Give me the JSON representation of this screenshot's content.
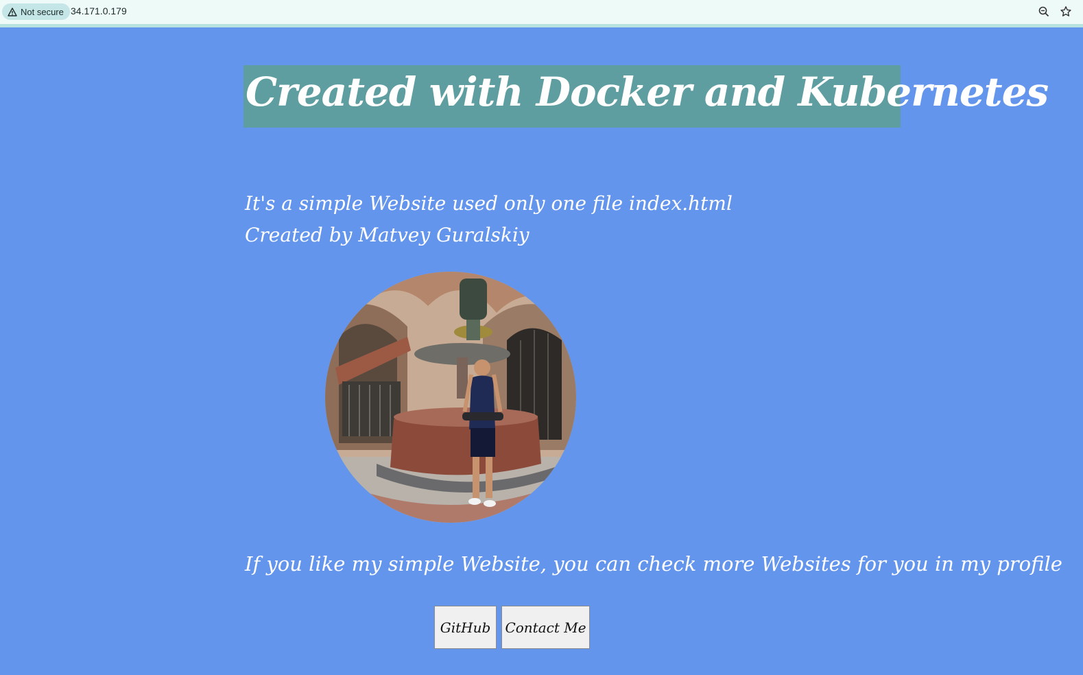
{
  "browser": {
    "security_label": "Not secure",
    "url": "34.171.0.179",
    "icons": [
      "warning-icon",
      "zoom-icon",
      "bookmark-star-icon"
    ]
  },
  "page": {
    "title": "Created with Docker and Kubernetes",
    "intro_line_1": "It's a simple Website used only one file index.html",
    "intro_line_2": "Created by Matvey Guralskiy",
    "profile_text": "If you like my simple Website, you can check more Websites for you in my profile",
    "buttons": {
      "github": "GitHub",
      "contact": "Contact Me"
    }
  },
  "colors": {
    "background": "#6495ED",
    "title_background": "#5F9EA0",
    "text": "#FFFFFF"
  }
}
